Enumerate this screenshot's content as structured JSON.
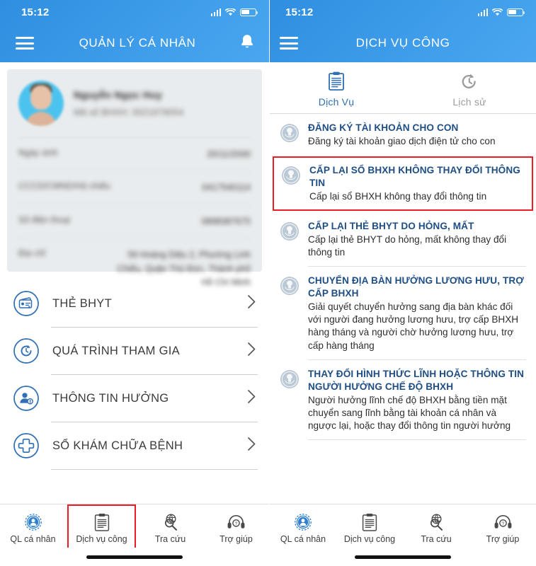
{
  "theme": {
    "header_blue": "#3b9ae8",
    "accent_blue": "#1f4e85",
    "highlight_red": "#ee1b24",
    "tab_active": "#2f6fb5",
    "tab_inactive": "#9c9c9c"
  },
  "left_screen": {
    "status": {
      "time": "15:12",
      "signal_icon": "cellular-signal-icon",
      "wifi_icon": "wifi-icon",
      "battery_icon": "battery-icon"
    },
    "header": {
      "menu_icon": "hamburger-menu-icon",
      "title": "QUẢN LÝ CÁ NHÂN",
      "bell_icon": "notification-bell-icon"
    },
    "profile": {
      "avatar_icon": "user-avatar-photo",
      "name": "Nguyễn Ngọc Huy",
      "subtitle": "Mã số BHXH: 0021979054",
      "rows": [
        {
          "label": "Ngày sinh",
          "value": "20/11/2000"
        },
        {
          "label": "CCCD/CMND/Hộ chiếu",
          "value": "0417540114"
        },
        {
          "label": "Số điện thoại",
          "value": "0898387675"
        },
        {
          "label": "Địa chỉ",
          "value": "59 Hoàng Diệu 2, Phường Linh Chiểu, Quận Thủ Đức, Thành phố Hồ Chí Minh"
        }
      ]
    },
    "menu": [
      {
        "icon": "health-insurance-card-icon",
        "label": "THẺ BHYT",
        "chevron": "chevron-right-icon"
      },
      {
        "icon": "history-clock-icon",
        "label": "QUÁ TRÌNH THAM GIA",
        "chevron": "chevron-right-icon"
      },
      {
        "icon": "user-info-icon",
        "label": "THÔNG TIN HƯỞNG",
        "chevron": "chevron-right-icon"
      },
      {
        "icon": "medical-cross-icon",
        "label": "SỔ KHÁM CHỮA BỆNH",
        "chevron": "chevron-right-icon"
      }
    ],
    "bottom_nav": [
      {
        "icon": "personal-management-icon",
        "label": "QL cá nhân",
        "active": false,
        "boxed": false
      },
      {
        "icon": "public-service-document-icon",
        "label": "Dịch vụ công",
        "active": true,
        "boxed": true
      },
      {
        "icon": "search-lookup-icon",
        "label": "Tra cứu",
        "active": false,
        "boxed": false
      },
      {
        "icon": "headset-support-icon",
        "label": "Trợ giúp",
        "active": false,
        "boxed": false
      }
    ]
  },
  "right_screen": {
    "status": {
      "time": "15:12",
      "signal_icon": "cellular-signal-icon",
      "wifi_icon": "wifi-icon",
      "battery_icon": "battery-icon"
    },
    "header": {
      "menu_icon": "hamburger-menu-icon",
      "title": "DỊCH VỤ CÔNG"
    },
    "tabs": [
      {
        "icon": "service-document-icon",
        "label": "Dịch Vụ",
        "active": true
      },
      {
        "icon": "history-rewind-icon",
        "label": "Lịch sử",
        "active": false
      }
    ],
    "services": [
      {
        "icon": "bhxh-logo-icon",
        "title": "ĐĂNG KÝ TÀI KHOẢN CHO CON",
        "description": "Đăng ký tài khoản giao dịch điện tử cho con",
        "highlighted": false
      },
      {
        "icon": "bhxh-logo-icon",
        "title": "CẤP LẠI SỔ BHXH KHÔNG THAY ĐỔI THÔNG TIN",
        "description": "Cấp lại sổ BHXH không thay đổi thông tin",
        "highlighted": true
      },
      {
        "icon": "bhxh-logo-icon",
        "title": "CẤP LẠI THẺ BHYT DO HỎNG, MẤT",
        "description": "Cấp lại thẻ BHYT do hỏng, mất không thay đổi thông tin",
        "highlighted": false
      },
      {
        "icon": "bhxh-logo-icon",
        "title": "CHUYỂN ĐỊA BÀN HƯỞNG LƯƠNG HƯU, TRỢ CẤP BHXH",
        "description": "Giải quyết chuyển hưởng sang địa bàn khác đối với người đang hưởng lương hưu, trợ cấp BHXH hàng tháng và người chờ hưởng lương hưu, trợ cấp hàng tháng",
        "highlighted": false
      },
      {
        "icon": "bhxh-logo-icon",
        "title": "THAY ĐỔI HÌNH THỨC LĨNH HOẶC THÔNG TIN NGƯỜI HƯỞNG CHẾ ĐỘ BHXH",
        "description": "Người hưởng lĩnh chế độ BHXH bằng tiền mặt chuyển sang lĩnh bằng tài khoản cá nhân và ngược lại, hoặc thay đổi thông tin người hưởng",
        "highlighted": false
      }
    ],
    "bottom_nav": [
      {
        "icon": "personal-management-icon",
        "label": "QL cá nhân",
        "active": false,
        "boxed": false
      },
      {
        "icon": "public-service-document-icon",
        "label": "Dịch vụ công",
        "active": false,
        "boxed": false
      },
      {
        "icon": "search-lookup-icon",
        "label": "Tra cứu",
        "active": false,
        "boxed": false
      },
      {
        "icon": "headset-support-icon",
        "label": "Trợ giúp",
        "active": false,
        "boxed": false
      }
    ]
  }
}
